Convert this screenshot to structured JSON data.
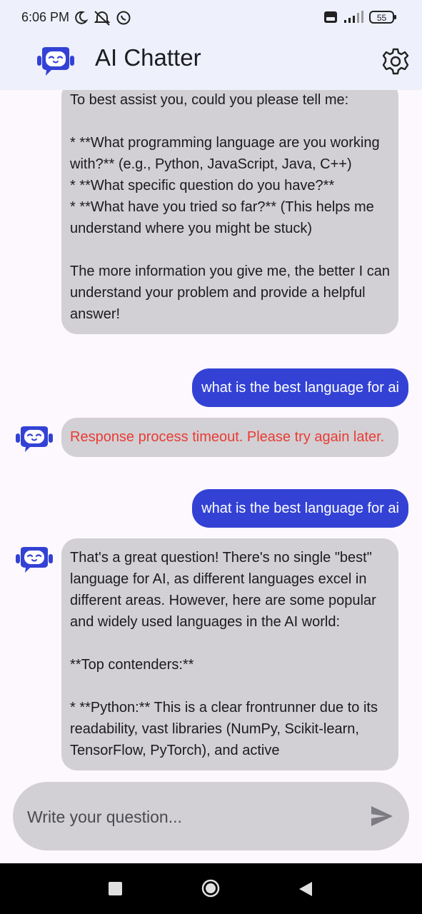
{
  "status_bar": {
    "time": "6:06 PM",
    "icons_left": [
      "moon-icon",
      "notifications-muted-icon",
      "whatsapp-icon"
    ],
    "icons_right": [
      "volte-icon",
      "signal-icon",
      "battery-icon"
    ],
    "battery": "55"
  },
  "app_bar": {
    "title": "AI Chatter",
    "logo_icon": "robot-icon",
    "settings_icon": "gear-icon"
  },
  "messages": [
    {
      "role": "bot",
      "text": "To best assist you, could you please tell me:\n\n* **What programming language are you working with?** (e.g., Python, JavaScript, Java, C++)\n* **What specific question do you have?**\n* **What have you tried so far?** (This helps me understand where you might be stuck)\n\nThe more information you give me, the better I can understand your problem and provide a helpful answer!"
    },
    {
      "role": "user",
      "text": "what is the best language for ai"
    },
    {
      "role": "bot",
      "error": true,
      "text": "Response process timeout. Please try again later."
    },
    {
      "role": "user",
      "text": "what is the best language for ai"
    },
    {
      "role": "bot",
      "text": "That's a great question! There's no single \"best\" language for AI, as different languages excel in different areas. However, here are some popular and widely used languages in the AI world:\n\n**Top contenders:**\n\n* **Python:** This is a clear frontrunner due to its readability, vast libraries (NumPy, Scikit-learn, TensorFlow, PyTorch), and active"
    }
  ],
  "composer": {
    "placeholder": "Write your question...",
    "send_icon": "send-icon"
  },
  "colors": {
    "accent": "#3342d4",
    "bot_bubble": "#d2d0d4",
    "error_text": "#ea3b34",
    "app_bar_bg": "#eef0fb"
  }
}
